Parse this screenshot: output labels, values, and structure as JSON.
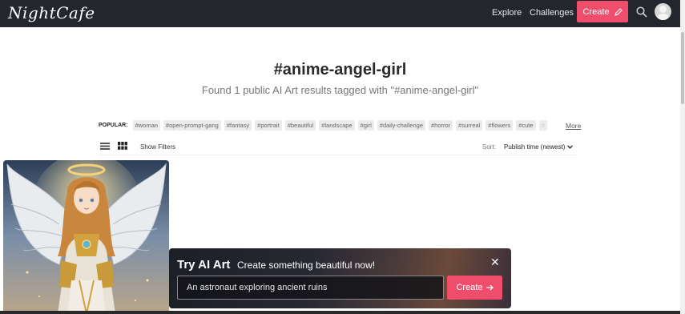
{
  "header": {
    "logo": "NightCafe",
    "nav": {
      "explore": "Explore",
      "challenges": "Challenges"
    },
    "create_label": "Create",
    "icons": {
      "search": "search-icon",
      "avatar": "avatar-icon",
      "create": "pencil-icon"
    }
  },
  "page": {
    "title": "#anime-angel-girl",
    "subtitle": "Found 1 public AI Art results tagged with \"#anime-angel-girl\""
  },
  "popular": {
    "label": "POPULAR:",
    "tags": [
      "#woman",
      "#open-prompt-gang",
      "#fantasy",
      "#portrait",
      "#beautiful",
      "#landscape",
      "#girl",
      "#daily-challenge",
      "#horror",
      "#surreal",
      "#flowers",
      "#cute",
      "#"
    ],
    "more_label": "More"
  },
  "toolbar": {
    "show_filters": "Show Filters",
    "sort_label": "Sort:",
    "sort_value": "Publish time (newest)"
  },
  "promo": {
    "title": "Try AI Art",
    "subtitle": "Create something beautiful now!",
    "input_value": "An astronaut exploring ancient ruins",
    "create_label": "Create",
    "close": "✕"
  },
  "colors": {
    "topbar": "#23262c",
    "accent": "#ef4d6c"
  }
}
